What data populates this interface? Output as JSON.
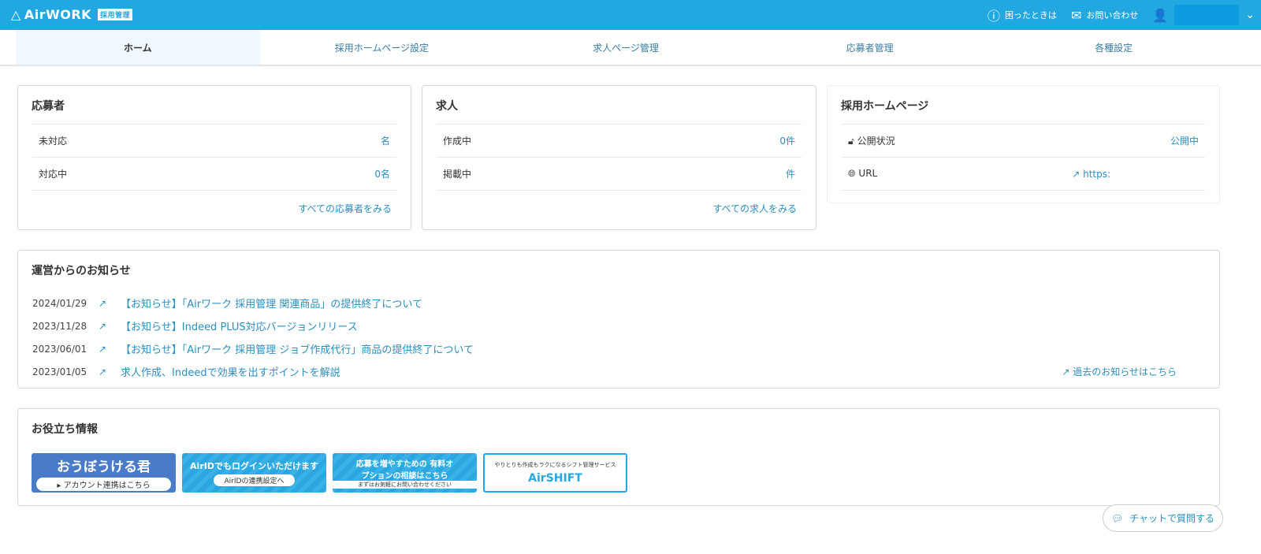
{
  "header": {
    "logo": "AirWORK",
    "logo_tag": "採用管理",
    "help": "困ったときは",
    "contact": "お問い合わせ"
  },
  "nav": [
    "ホーム",
    "採用ホームページ設定",
    "求人ページ管理",
    "応募者管理",
    "各種設定"
  ],
  "applicants": {
    "title": "応募者",
    "rows": [
      {
        "label": "未対応",
        "value": "名"
      },
      {
        "label": "対応中",
        "value": "0名"
      }
    ],
    "more": "すべての応募者をみる"
  },
  "jobs": {
    "title": "求人",
    "rows": [
      {
        "label": "作成中",
        "value": "0件"
      },
      {
        "label": "掲載中",
        "value": "件"
      }
    ],
    "more": "すべての求人をみる"
  },
  "homepage": {
    "title": "採用ホームページ",
    "rows": [
      {
        "label": "公開状況",
        "value": "公開中"
      },
      {
        "label": "URL",
        "value": "https:"
      }
    ]
  },
  "news": {
    "title": "運営からのお知らせ",
    "items": [
      {
        "date": "2024/01/29",
        "text": "【お知らせ】「Airワーク 採用管理 関連商品」の提供終了について"
      },
      {
        "date": "2023/11/28",
        "text": "【お知らせ】Indeed PLUS対応バージョンリリース"
      },
      {
        "date": "2023/06/01",
        "text": "【お知らせ】「Airワーク 採用管理 ジョブ作成代行」商品の提供終了について"
      },
      {
        "date": "2023/01/05",
        "text": "求人作成、Indeedで効果を出すポイントを解説"
      }
    ],
    "past": "過去のお知らせはこちら"
  },
  "useful": {
    "title": "お役立ち情報",
    "banners": [
      {
        "main": "おうぼうける君",
        "sub": "▸ アカウント連携はこちら"
      },
      {
        "main": "AirIDでもログインいただけます",
        "sub": "AirIDの連携設定へ"
      },
      {
        "main": "応募を増やすための 有料オプションの相談はこちら",
        "sub": "まずはお気軽にお問い合わせください"
      },
      {
        "main": "AirSHIFT",
        "sub": "やりとりも作成もラクになるシフト管理サービス"
      }
    ]
  },
  "chat": "チャットで質問する"
}
